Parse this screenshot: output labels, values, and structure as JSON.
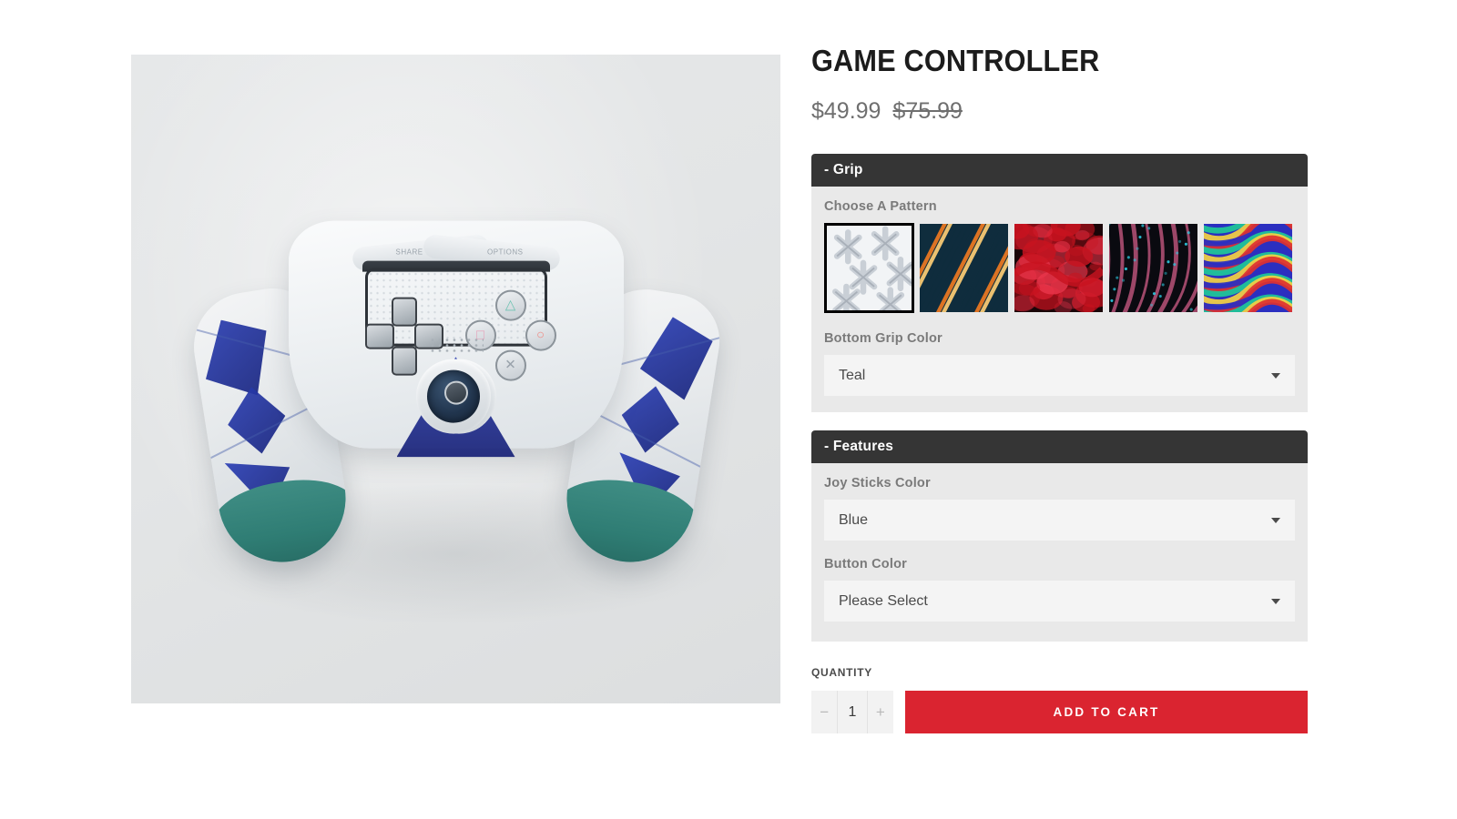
{
  "product": {
    "title": "GAME CONTROLLER",
    "price_current": "$49.99",
    "price_compare": "$75.99",
    "image_alt": "game-controller-product-image"
  },
  "option_groups": [
    {
      "header": "- Grip",
      "pattern_field": {
        "label": "Choose A Pattern",
        "selected_index": 0,
        "swatches": [
          {
            "name": "white-lattice-pattern",
            "selected": true,
            "colors": [
              "#f2f4f6",
              "#c9cfd6",
              "#8e97a2"
            ]
          },
          {
            "name": "dark-teal-orange-streak-pattern",
            "selected": false,
            "colors": [
              "#0f2d3d",
              "#e87722",
              "#f7c873"
            ]
          },
          {
            "name": "red-marble-pattern",
            "selected": false,
            "colors": [
              "#1a0508",
              "#c8131f",
              "#e8354a"
            ]
          },
          {
            "name": "black-pink-cyan-cells-pattern",
            "selected": false,
            "colors": [
              "#0a0a10",
              "#c2567e",
              "#2bc9e0"
            ]
          },
          {
            "name": "iridescent-oil-slick-pattern",
            "selected": false,
            "colors": [
              "#2b2fc0",
              "#20c997",
              "#f5d142",
              "#e0312f"
            ]
          }
        ]
      },
      "selects": [
        {
          "name": "bottom-grip-color",
          "label": "Bottom Grip Color",
          "value": "Teal"
        }
      ]
    },
    {
      "header": "- Features",
      "selects": [
        {
          "name": "joy-sticks-color",
          "label": "Joy Sticks Color",
          "value": "Blue"
        },
        {
          "name": "button-color",
          "label": "Button Color",
          "value": "Please Select"
        }
      ]
    }
  ],
  "purchase": {
    "quantity_label": "QUANTITY",
    "quantity_value": "1",
    "decrease_label": "−",
    "increase_label": "+",
    "add_to_cart_label": "ADD TO CART"
  },
  "colors": {
    "accent_red": "#da2430",
    "header_dark": "#353535",
    "panel_bg": "#e9e9e9",
    "select_bg": "#f4f4f4",
    "label_gray": "#7a7a7a",
    "price_gray": "#6f6f6f",
    "gallery_bg": "#e3e5e6"
  },
  "controller_art": {
    "face_buttons": [
      "△",
      "□",
      "○",
      "✕"
    ],
    "share_label": "SHARE",
    "options_label": "OPTIONS"
  }
}
